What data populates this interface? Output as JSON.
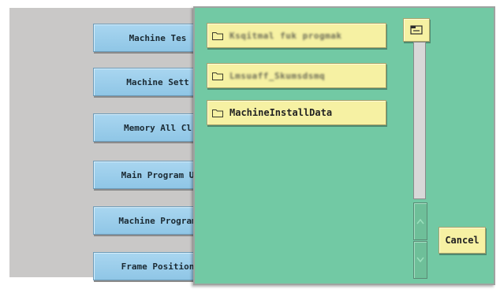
{
  "menu": {
    "items": [
      {
        "label": "Machine Tes"
      },
      {
        "label": "Machine Sett"
      },
      {
        "label": "Memory All Cl"
      },
      {
        "label": "Main Program U"
      },
      {
        "label": "Machine Program"
      },
      {
        "label": "Frame Position"
      }
    ]
  },
  "dialog": {
    "folders": [
      {
        "label": "Ksqitmal fuk progmak",
        "blurred": true
      },
      {
        "label": "Lmsuaff_Skumsdsmq",
        "blurred": true
      },
      {
        "label": "MachineInstallData",
        "blurred": false
      }
    ],
    "cancel_label": "Cancel",
    "scroll_up_icon": "chevron-up-icon",
    "scroll_down_icon": "chevron-down-icon",
    "parent_folder_icon": "folder-up-icon"
  },
  "colors": {
    "dialog_bg": "#72c9a4",
    "folder_button": "#f6f1a3",
    "menu_button": "#a9d6f0",
    "background_panel": "#c9c8c7"
  }
}
